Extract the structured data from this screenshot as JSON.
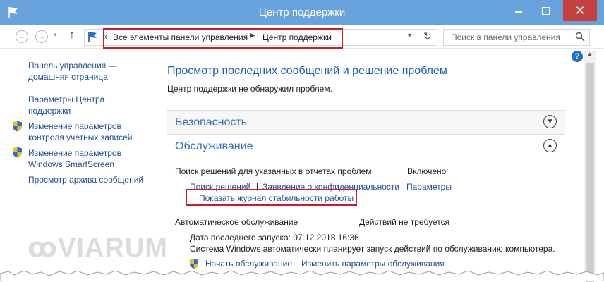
{
  "window": {
    "title": "Центр поддержки",
    "close_glyph": "✕"
  },
  "nav": {
    "back_icon": "arrow-left-icon",
    "forward_icon": "arrow-right-icon",
    "up_glyph": "↑",
    "breadcrumb": [
      "Все элементы панели управления",
      "Центр поддержки"
    ],
    "search_placeholder": "Поиск в панели управления"
  },
  "help_glyph": "?",
  "sidebar": {
    "items": [
      {
        "label": "Панель управления —\nдомашняя страница",
        "icon": null
      },
      {
        "label": "Параметры Центра\nподдержки",
        "icon": null
      },
      {
        "label": "Изменение параметров\nконтроля учетных записей",
        "icon": "uac-shield-icon"
      },
      {
        "label": "Изменение параметров\nWindows SmartScreen",
        "icon": "uac-shield-icon"
      },
      {
        "label": "Просмотр архива сообщений",
        "icon": null
      }
    ]
  },
  "main": {
    "heading": "Просмотр последних сообщений и решение проблем",
    "status": "Центр поддержки не обнаружил проблем.",
    "security": {
      "title": "Безопасность"
    },
    "maintenance": {
      "title": "Обслуживание",
      "problem_reports": {
        "label": "Поиск решений для указанных в отчетах проблем",
        "value": "Включено",
        "links": [
          "Поиск решений",
          "Заявление о конфиденциальности",
          "Параметры"
        ],
        "reliability_link": "Показать журнал стабильности работы"
      },
      "auto_maintenance": {
        "label": "Автоматическое обслуживание",
        "value": "Действий не требуется",
        "last_run": "Дата последнего запуска: 07.12.2018 16:36",
        "description": "Система Windows автоматически планирует запуск действий по обслуживанию компьютера.",
        "links": [
          "Начать обслуживание",
          "Изменить параметры обслуживания"
        ]
      }
    }
  },
  "watermark": "VIARUM",
  "colors": {
    "titlebar": "#68a3de",
    "link": "#1f4e9c",
    "heading": "#1e5fbf",
    "highlight_box": "#d21a22"
  }
}
